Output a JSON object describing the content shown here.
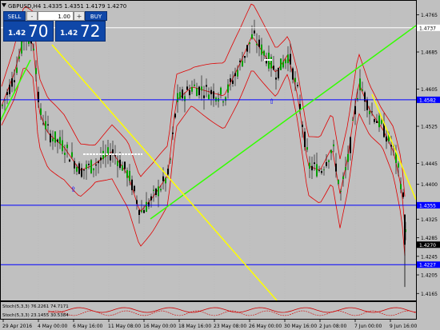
{
  "window": {
    "symbol_info": "GBPUSD,H4  1.4335 1.4351 1.4179 1.4270"
  },
  "trade_panel": {
    "sell_label": "SELL",
    "buy_label": "BUY",
    "lot_value": "1.00",
    "minus_label": "-",
    "plus_label": "+",
    "sell_price_small": "1.42",
    "sell_price_big": "70",
    "buy_price_small": "1.42",
    "buy_price_big": "72"
  },
  "price_axis": {
    "ticks": [
      "1.4765",
      "1.4685",
      "1.4605",
      "1.4525",
      "1.4445",
      "1.4400",
      "1.4325",
      "1.4285",
      "1.4245",
      "1.4205",
      "1.4165"
    ],
    "labels_badges": [
      {
        "value": "1.4737",
        "kind": "white-line"
      },
      {
        "value": "1.4582",
        "kind": "blue-line"
      },
      {
        "value": "1.4355",
        "kind": "blue-line"
      },
      {
        "value": "1.4270",
        "kind": "current"
      },
      {
        "value": "1.4227",
        "kind": "blue-line"
      }
    ],
    "current_price": "1.4270"
  },
  "time_axis": {
    "labels": [
      "29 Apr 2016",
      "4 May 00:00",
      "6 May 16:00",
      "11 May 08:00",
      "16 May 00:00",
      "18 May 16:00",
      "23 May 08:00",
      "26 May 00:00",
      "30 May 16:00",
      "2 Jun 08:00",
      "7 Jun 00:00",
      "9 Jun 16:00"
    ]
  },
  "indicators": {
    "line1": "Stoch(5,3,3) 76.2261 74.7171",
    "line2": "Stoch(5,3,3) 23.1455 30.5384"
  },
  "colors": {
    "background": "#c0c0c0",
    "bull_candle": "#00a000",
    "bear_candle": "#000000",
    "bollinger": "#e00000",
    "trend_green": "#33ff00",
    "trend_yellow": "#ffff00",
    "hline_blue": "#0000ff",
    "panel_blue": "#0f47a8"
  }
}
